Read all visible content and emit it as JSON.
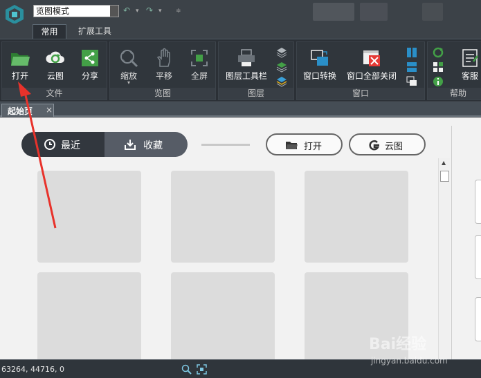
{
  "titlebar": {
    "mode_select": "览图模式"
  },
  "ribbon_tabs": [
    {
      "label": "常用",
      "active": true
    },
    {
      "label": "扩展工具",
      "active": false
    }
  ],
  "ribbon": {
    "groups": {
      "file": {
        "label": "文件",
        "buttons": [
          {
            "label": "打开",
            "icon": "folder-open-icon"
          },
          {
            "label": "云图",
            "icon": "cloud-refresh-icon"
          },
          {
            "label": "分享",
            "icon": "share-icon"
          }
        ]
      },
      "view": {
        "label": "览图",
        "buttons": [
          {
            "label": "缩放",
            "icon": "zoom-icon"
          },
          {
            "label": "平移",
            "icon": "pan-hand-icon"
          },
          {
            "label": "全屏",
            "icon": "fullscreen-icon"
          }
        ]
      },
      "layer": {
        "label": "图层",
        "buttons": [
          {
            "label": "图层工具栏",
            "icon": "layer-toolbar-icon"
          }
        ]
      },
      "window": {
        "label": "窗口",
        "buttons": [
          {
            "label": "窗口转换",
            "icon": "window-switch-icon"
          },
          {
            "label": "窗口全部关闭",
            "icon": "close-all-windows-icon"
          }
        ]
      },
      "help": {
        "label": "帮助",
        "buttons": [
          {
            "label": "客服",
            "icon": "customer-service-icon"
          }
        ]
      }
    }
  },
  "document_tab": {
    "label": "起始页",
    "close": "×"
  },
  "startpage": {
    "recent_label": "最近",
    "favorites_label": "收藏",
    "open_label": "打开",
    "cloud_label": "云图"
  },
  "statusbar": {
    "coords": "63264, 44716, 0"
  },
  "watermark": {
    "text": "Bai经验",
    "url": "jingyan.baidu.com"
  },
  "colors": {
    "ribbon_bg": "#2b3036",
    "accent_green": "#4caf50",
    "annotation_red": "#e8322b",
    "card_bg": "#dcdcdc"
  }
}
